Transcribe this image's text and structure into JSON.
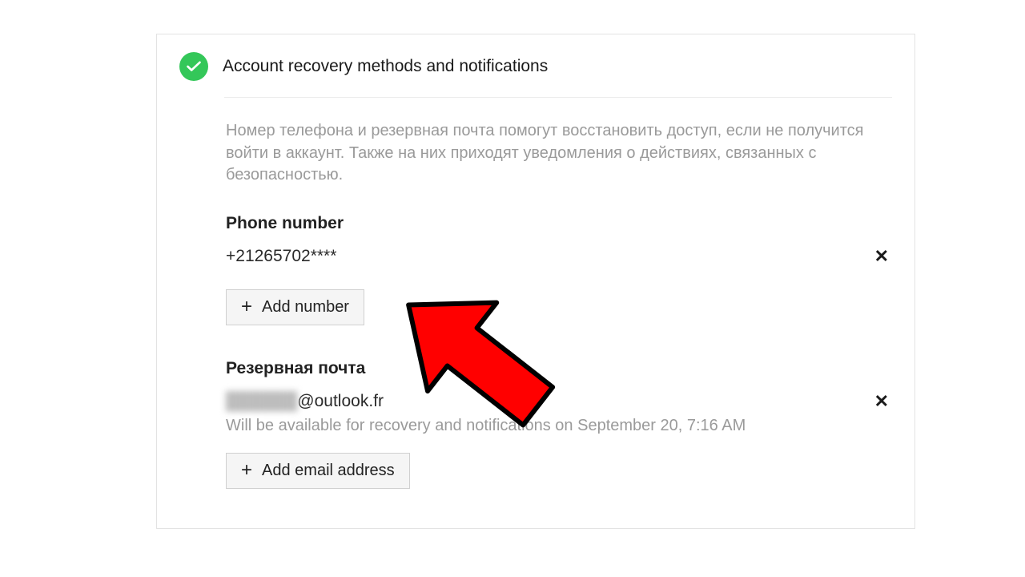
{
  "header": {
    "title": "Account recovery methods and notifications"
  },
  "description": "Номер телефона и резервная почта помогут восстановить доступ, если не получится войти в аккаунт. Также на них приходят уведомления о действиях, связанных с безопасностью.",
  "phone": {
    "label": "Phone number",
    "value": "+21265702****",
    "add_button": "Add number"
  },
  "email": {
    "label": "Резервная почта",
    "local_blurred": "██████",
    "domain": "@outlook.fr",
    "note": "Will be available for recovery and notifications on September 20, 7:16 AM",
    "add_button": "Add email address"
  },
  "icons": {
    "remove": "✕"
  }
}
